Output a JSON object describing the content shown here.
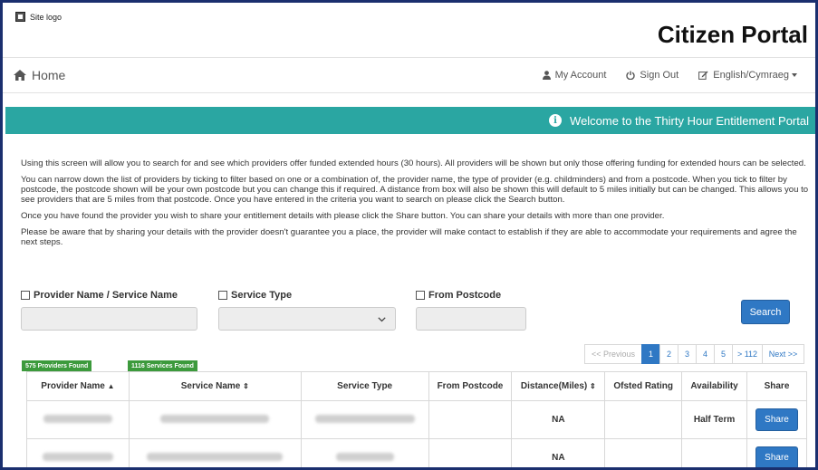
{
  "header": {
    "logo_alt": "Site logo",
    "title": "Citizen Portal"
  },
  "nav": {
    "home": "Home",
    "my_account": "My Account",
    "sign_out": "Sign Out",
    "language": "English/Cymraeg"
  },
  "banner": {
    "info_glyph": "i",
    "text": "Welcome to the Thirty Hour Entitlement Portal"
  },
  "intro": {
    "p1": "Using this screen will allow you to search for and see which providers offer funded extended hours (30 hours). All providers will be shown but only those offering funding for extended hours can be selected.",
    "p2": "You can narrow down the list of providers by ticking to filter based on one or a combination of, the provider name, the type of provider (e.g. childminders) and from a postcode. When you tick to filter by postcode, the postcode shown will be your own postcode but you can change this if required. A distance from box will also be shown this will default to 5 miles initially but can be changed. This allows you to see providers that are 5 miles from that postcode. Once you have entered in the criteria you want to search on please click the Search button.",
    "p3": "Once you have found the provider you wish to share your entitlement details with please click the Share button. You can share your details with more than one provider.",
    "p4": "Please be aware that by sharing your details with the provider doesn't guarantee you a place, the provider will make contact to establish if they are able to accommodate your requirements and agree the next steps."
  },
  "filters": {
    "provider_name_label": "Provider Name / Service Name",
    "service_type_label": "Service Type",
    "from_postcode_label": "From Postcode",
    "provider_name_value": "",
    "service_type_value": "",
    "from_postcode_value": "",
    "search_label": "Search"
  },
  "counts": {
    "providers": "575 Providers Found",
    "services": "1116 Services Found"
  },
  "pagination": {
    "prev": "<< Previous",
    "pages": [
      "1",
      "2",
      "3",
      "4",
      "5",
      "> 112"
    ],
    "next": "Next >>",
    "active_page": "1"
  },
  "table": {
    "headers": {
      "provider_name": "Provider Name",
      "provider_sort": "▲",
      "service_name": "Service Name",
      "service_sort": "⇕",
      "service_type": "Service Type",
      "from_postcode": "From Postcode",
      "distance": "Distance(Miles)",
      "distance_sort": "⇕",
      "ofsted": "Ofsted Rating",
      "availability": "Availability",
      "share": "Share"
    },
    "rows": [
      {
        "distance": "NA",
        "ofsted": "",
        "availability": "Half Term",
        "share_label": "Share"
      },
      {
        "distance": "NA",
        "ofsted": "",
        "availability": "",
        "share_label": "Share"
      }
    ]
  },
  "colors": {
    "banner": "#2aa6a2",
    "primary_button": "#2f78c4",
    "badge": "#3c9a3c",
    "frame_border": "#1a2f6e"
  }
}
